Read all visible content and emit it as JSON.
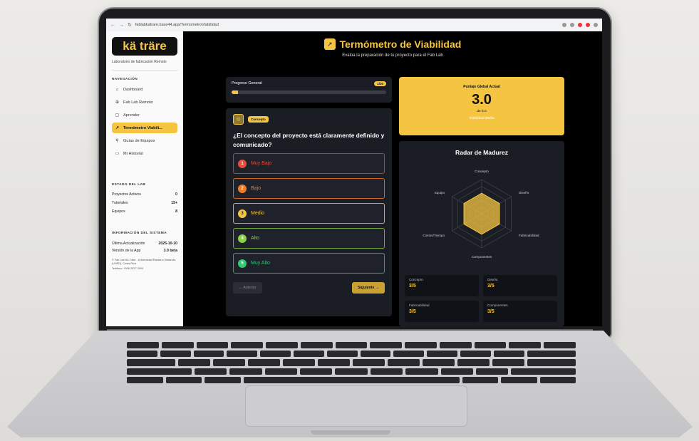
{
  "browser": {
    "url": "fablabkatrare.base44.app/TermometroViabilidad"
  },
  "sidebar": {
    "logo": "kä träre",
    "subtitle": "Laboratorio de fabricación Remoto",
    "nav_title": "NAVEGACIÓN",
    "nav_items": [
      {
        "label": "Dashboard",
        "icon": "⌂"
      },
      {
        "label": "Fab Lab Remoto",
        "icon": "⊕"
      },
      {
        "label": "Aprender",
        "icon": "▢"
      },
      {
        "label": "Termómetro Viabili...",
        "icon": "↗"
      },
      {
        "label": "Guías de Equipos",
        "icon": "⚲"
      },
      {
        "label": "Mi Historial",
        "icon": "▭"
      }
    ],
    "lab_title": "ESTADO DEL LAB",
    "lab_stats": [
      {
        "label": "Proyectos Activos",
        "value": "0"
      },
      {
        "label": "Tutoriales",
        "value": "15+"
      },
      {
        "label": "Equipos",
        "value": "8"
      }
    ],
    "info_title": "INFORMACIÓN DEL SISTEMA",
    "last_update_label": "Última Actualización",
    "last_update_value": "2025-10-10",
    "version_label": "Versión de la App",
    "version_value": "3.0 beta",
    "footer": "© Fab Lab Kä Träre - Universidad Estatal a Distancia (UNED), Costa Rica",
    "phone": "Teléfono: +506 2527-2000"
  },
  "main": {
    "title": "Termómetro de Viabilidad",
    "subtitle": "Evalúa la preparación de tu proyecto para el Fab Lab",
    "progress_label": "Progreso General",
    "progress_count": "1/30",
    "progress_fraction": 0.04,
    "question_tag": "Concepto",
    "question_text": "¿El concepto del proyecto está claramente definido y comunicado?",
    "options": [
      {
        "num": "1",
        "label": "Muy Bajo",
        "color": "#e74c3c"
      },
      {
        "num": "2",
        "label": "Bajo",
        "color": "#f07c2a"
      },
      {
        "num": "3",
        "label": "Medio",
        "color": "#f5c542"
      },
      {
        "num": "4",
        "label": "Alto",
        "color": "#8bd148"
      },
      {
        "num": "5",
        "label": "Muy Alto",
        "color": "#2ecc71"
      }
    ],
    "prev_label": "← Anterior",
    "next_label": "Siguiente →"
  },
  "score": {
    "label": "Puntaje Global Actual",
    "value": "3.0",
    "of": "de 5.0",
    "status": "Viabilidad Media"
  },
  "radar": {
    "title": "Radar de Madurez",
    "axes": [
      "Concepto",
      "Diseño",
      "Fabricabilidad",
      "Componentes",
      "Costos/Tiempo",
      "Equipo"
    ],
    "values": [
      3,
      3,
      3,
      3,
      3,
      3
    ],
    "max": 5
  },
  "metrics": [
    {
      "name": "Concepto",
      "value": "3/5"
    },
    {
      "name": "Diseño",
      "value": "3/5"
    },
    {
      "name": "Fabricabilidad",
      "value": "3/5"
    },
    {
      "name": "Componentes",
      "value": "3/5"
    }
  ],
  "colors": {
    "accent": "#f5c542",
    "panel": "#1a1d24"
  }
}
